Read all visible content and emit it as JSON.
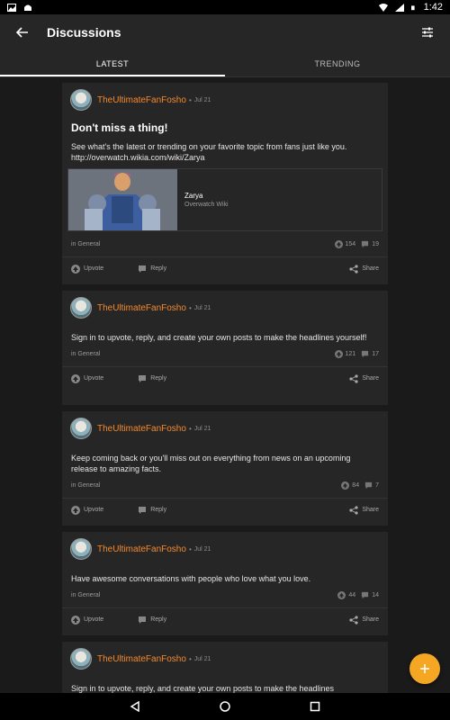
{
  "status_bar": {
    "time": "1:42"
  },
  "app_bar": {
    "title": "Discussions"
  },
  "tabs": [
    {
      "label": "LATEST",
      "active": true
    },
    {
      "label": "TRENDING",
      "active": false
    }
  ],
  "posts": [
    {
      "author": "TheUltimateFanFosho",
      "date": "Jul 21",
      "title": "Don't miss a thing!",
      "body": "See what's the latest or trending on your favorite topic from fans just like you. http://overwatch.wikia.com/wiki/Zarya",
      "embed": {
        "title": "Zarya",
        "subtitle": "Overwatch Wiki"
      },
      "category": "in General",
      "upvotes": "154",
      "replies": "19"
    },
    {
      "author": "TheUltimateFanFosho",
      "date": "Jul 21",
      "title": "",
      "body": "Sign in to upvote, reply, and create your own posts to make the headlines yourself!",
      "category": "in General",
      "upvotes": "121",
      "replies": "17"
    },
    {
      "author": "TheUltimateFanFosho",
      "date": "Jul 21",
      "title": "",
      "body": "Keep coming back or you'll miss out on everything from news on an upcoming release to amazing facts.",
      "category": "in General",
      "upvotes": "84",
      "replies": "7"
    },
    {
      "author": "TheUltimateFanFosho",
      "date": "Jul 21",
      "title": "",
      "body": "Have awesome conversations with people who love what you love.",
      "category": "in General",
      "upvotes": "44",
      "replies": "14"
    },
    {
      "author": "TheUltimateFanFosho",
      "date": "Jul 21",
      "title": "",
      "body": "Sign in to upvote, reply, and create your own posts to make the headlines"
    }
  ],
  "actions": {
    "upvote": "Upvote",
    "reply": "Reply",
    "share": "Share"
  },
  "colors": {
    "accent": "#f5892c",
    "fab": "#f5a623",
    "card": "#262626",
    "background": "#1a1a1a"
  },
  "icons": {
    "back": "arrow-left-icon",
    "filter": "sliders-icon",
    "upvote": "upvote-circle-icon",
    "reply": "chat-bubble-icon",
    "share": "share-icon",
    "fab": "plus-icon"
  }
}
